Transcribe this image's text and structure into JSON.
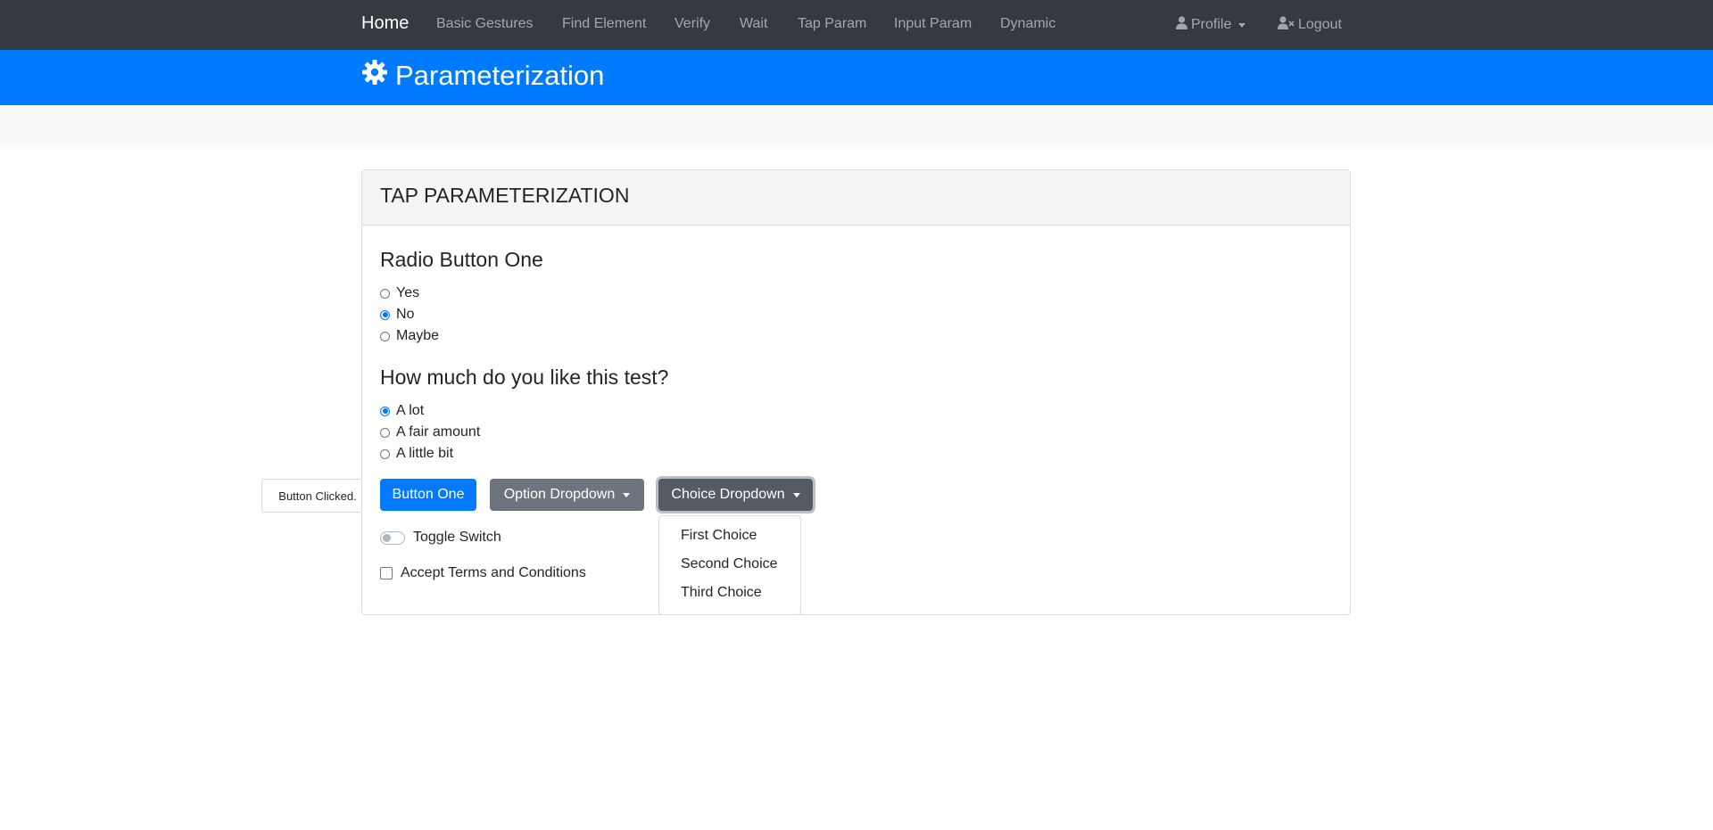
{
  "navbar": {
    "brand": "Home",
    "links": [
      "Basic Gestures",
      "Find Element",
      "Verify",
      "Wait",
      "Tap Param",
      "Input Param",
      "Dynamic"
    ],
    "profile_label": "Profile",
    "logout_label": "Logout"
  },
  "header": {
    "title": "Parameterization"
  },
  "card": {
    "title": "TAP PARAMETERIZATION",
    "radio_group_one": {
      "title": "Radio Button One",
      "options": [
        "Yes",
        "No",
        "Maybe"
      ],
      "selected": "No"
    },
    "radio_group_two": {
      "title": "How much do you like this test?",
      "options": [
        "A lot",
        "A fair amount",
        "A little bit"
      ],
      "selected": "A lot"
    },
    "buttons": {
      "button_one": "Button One",
      "option_dropdown": "Option Dropdown",
      "choice_dropdown": "Choice Dropdown"
    },
    "tooltip": "Button Clicked.",
    "toggle_label": "Toggle Switch",
    "checkbox_label": "Accept Terms and Conditions",
    "choice_menu": [
      "First Choice",
      "Second Choice",
      "Third Choice"
    ]
  },
  "colors": {
    "navbar": "#343a40",
    "primary": "#007bff",
    "secondary": "#6c757d"
  },
  "icons": {
    "header": "gear-icon",
    "profile": "user-icon",
    "logout": "user-x-icon"
  }
}
